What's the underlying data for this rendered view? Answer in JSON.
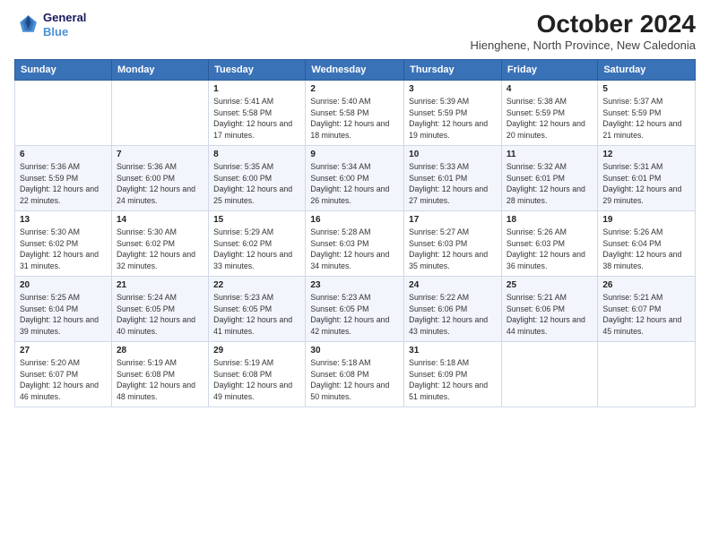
{
  "header": {
    "logo_line1": "General",
    "logo_line2": "Blue",
    "title": "October 2024",
    "location": "Hienghene, North Province, New Caledonia"
  },
  "weekdays": [
    "Sunday",
    "Monday",
    "Tuesday",
    "Wednesday",
    "Thursday",
    "Friday",
    "Saturday"
  ],
  "weeks": [
    [
      {
        "day": "",
        "info": ""
      },
      {
        "day": "",
        "info": ""
      },
      {
        "day": "1",
        "info": "Sunrise: 5:41 AM\nSunset: 5:58 PM\nDaylight: 12 hours and 17 minutes."
      },
      {
        "day": "2",
        "info": "Sunrise: 5:40 AM\nSunset: 5:58 PM\nDaylight: 12 hours and 18 minutes."
      },
      {
        "day": "3",
        "info": "Sunrise: 5:39 AM\nSunset: 5:59 PM\nDaylight: 12 hours and 19 minutes."
      },
      {
        "day": "4",
        "info": "Sunrise: 5:38 AM\nSunset: 5:59 PM\nDaylight: 12 hours and 20 minutes."
      },
      {
        "day": "5",
        "info": "Sunrise: 5:37 AM\nSunset: 5:59 PM\nDaylight: 12 hours and 21 minutes."
      }
    ],
    [
      {
        "day": "6",
        "info": "Sunrise: 5:36 AM\nSunset: 5:59 PM\nDaylight: 12 hours and 22 minutes."
      },
      {
        "day": "7",
        "info": "Sunrise: 5:36 AM\nSunset: 6:00 PM\nDaylight: 12 hours and 24 minutes."
      },
      {
        "day": "8",
        "info": "Sunrise: 5:35 AM\nSunset: 6:00 PM\nDaylight: 12 hours and 25 minutes."
      },
      {
        "day": "9",
        "info": "Sunrise: 5:34 AM\nSunset: 6:00 PM\nDaylight: 12 hours and 26 minutes."
      },
      {
        "day": "10",
        "info": "Sunrise: 5:33 AM\nSunset: 6:01 PM\nDaylight: 12 hours and 27 minutes."
      },
      {
        "day": "11",
        "info": "Sunrise: 5:32 AM\nSunset: 6:01 PM\nDaylight: 12 hours and 28 minutes."
      },
      {
        "day": "12",
        "info": "Sunrise: 5:31 AM\nSunset: 6:01 PM\nDaylight: 12 hours and 29 minutes."
      }
    ],
    [
      {
        "day": "13",
        "info": "Sunrise: 5:30 AM\nSunset: 6:02 PM\nDaylight: 12 hours and 31 minutes."
      },
      {
        "day": "14",
        "info": "Sunrise: 5:30 AM\nSunset: 6:02 PM\nDaylight: 12 hours and 32 minutes."
      },
      {
        "day": "15",
        "info": "Sunrise: 5:29 AM\nSunset: 6:02 PM\nDaylight: 12 hours and 33 minutes."
      },
      {
        "day": "16",
        "info": "Sunrise: 5:28 AM\nSunset: 6:03 PM\nDaylight: 12 hours and 34 minutes."
      },
      {
        "day": "17",
        "info": "Sunrise: 5:27 AM\nSunset: 6:03 PM\nDaylight: 12 hours and 35 minutes."
      },
      {
        "day": "18",
        "info": "Sunrise: 5:26 AM\nSunset: 6:03 PM\nDaylight: 12 hours and 36 minutes."
      },
      {
        "day": "19",
        "info": "Sunrise: 5:26 AM\nSunset: 6:04 PM\nDaylight: 12 hours and 38 minutes."
      }
    ],
    [
      {
        "day": "20",
        "info": "Sunrise: 5:25 AM\nSunset: 6:04 PM\nDaylight: 12 hours and 39 minutes."
      },
      {
        "day": "21",
        "info": "Sunrise: 5:24 AM\nSunset: 6:05 PM\nDaylight: 12 hours and 40 minutes."
      },
      {
        "day": "22",
        "info": "Sunrise: 5:23 AM\nSunset: 6:05 PM\nDaylight: 12 hours and 41 minutes."
      },
      {
        "day": "23",
        "info": "Sunrise: 5:23 AM\nSunset: 6:05 PM\nDaylight: 12 hours and 42 minutes."
      },
      {
        "day": "24",
        "info": "Sunrise: 5:22 AM\nSunset: 6:06 PM\nDaylight: 12 hours and 43 minutes."
      },
      {
        "day": "25",
        "info": "Sunrise: 5:21 AM\nSunset: 6:06 PM\nDaylight: 12 hours and 44 minutes."
      },
      {
        "day": "26",
        "info": "Sunrise: 5:21 AM\nSunset: 6:07 PM\nDaylight: 12 hours and 45 minutes."
      }
    ],
    [
      {
        "day": "27",
        "info": "Sunrise: 5:20 AM\nSunset: 6:07 PM\nDaylight: 12 hours and 46 minutes."
      },
      {
        "day": "28",
        "info": "Sunrise: 5:19 AM\nSunset: 6:08 PM\nDaylight: 12 hours and 48 minutes."
      },
      {
        "day": "29",
        "info": "Sunrise: 5:19 AM\nSunset: 6:08 PM\nDaylight: 12 hours and 49 minutes."
      },
      {
        "day": "30",
        "info": "Sunrise: 5:18 AM\nSunset: 6:08 PM\nDaylight: 12 hours and 50 minutes."
      },
      {
        "day": "31",
        "info": "Sunrise: 5:18 AM\nSunset: 6:09 PM\nDaylight: 12 hours and 51 minutes."
      },
      {
        "day": "",
        "info": ""
      },
      {
        "day": "",
        "info": ""
      }
    ]
  ]
}
